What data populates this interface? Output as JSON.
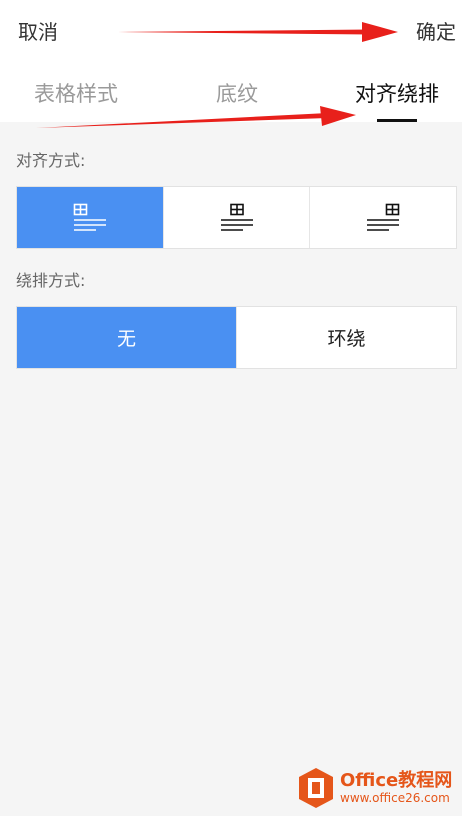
{
  "header": {
    "cancel_label": "取消",
    "confirm_label": "确定"
  },
  "tabs": [
    {
      "label": "表格样式",
      "active": false
    },
    {
      "label": "底纹",
      "active": false
    },
    {
      "label": "对齐绕排",
      "active": true
    }
  ],
  "alignment": {
    "label": "对齐方式:",
    "options": [
      {
        "name": "align-left-icon",
        "active": true
      },
      {
        "name": "align-center-icon",
        "active": false
      },
      {
        "name": "align-right-icon",
        "active": false
      }
    ]
  },
  "wrap": {
    "label": "绕排方式:",
    "options": [
      {
        "label": "无",
        "active": true
      },
      {
        "label": "环绕",
        "active": false
      }
    ]
  },
  "watermark": {
    "line1": "Office教程网",
    "line2": "www.office26.com"
  },
  "colors": {
    "accent": "#4a90f2",
    "arrow": "#e8201b",
    "watermark": "#e5561a"
  }
}
